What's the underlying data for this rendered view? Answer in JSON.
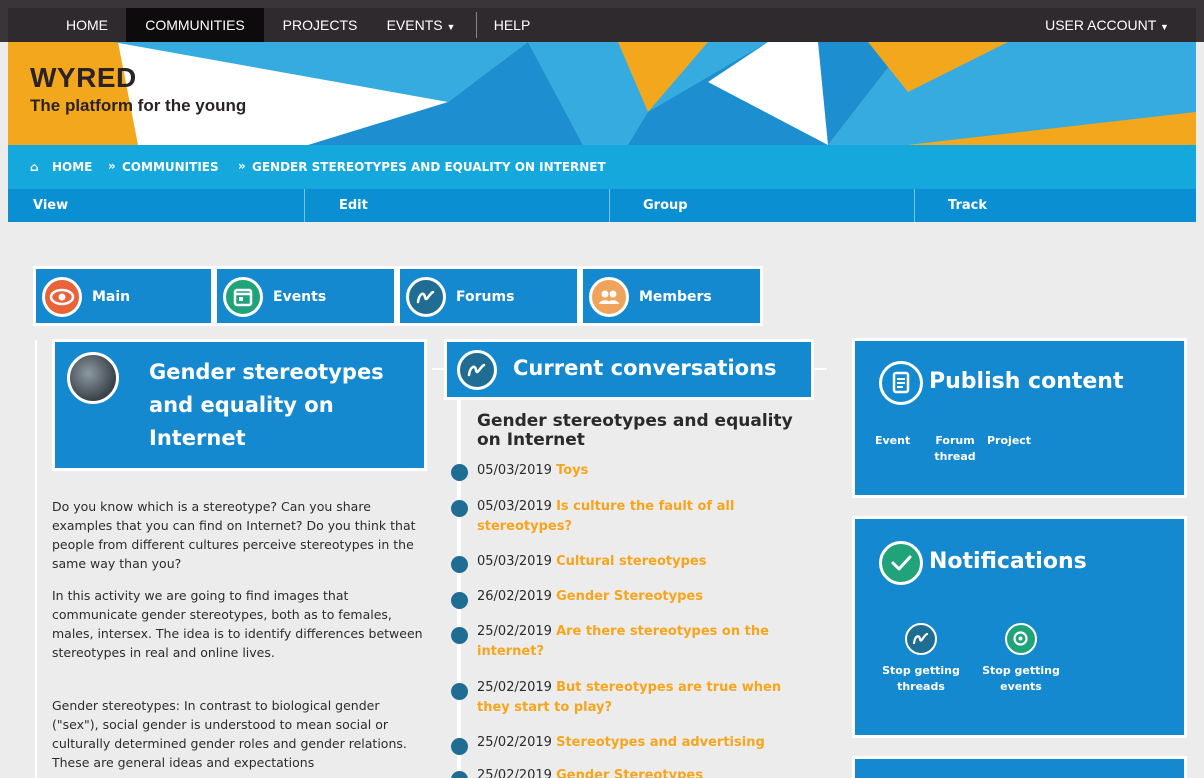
{
  "nav": {
    "items": [
      "HOME",
      "COMMUNITIES",
      "PROJECTS",
      "EVENTS",
      "HELP"
    ],
    "active": "COMMUNITIES",
    "account": "USER ACCOUNT"
  },
  "brand": {
    "title": "WYRED",
    "tagline": "The platform for the young"
  },
  "colors": {
    "accent_blue": "#1589cf",
    "orange": "#f3a71d",
    "link_orange": "#f6a51d",
    "dark": "#2f2a2e"
  },
  "breadcrumb": [
    "HOME",
    "COMMUNITIES",
    "GENDER STEREOTYPES AND EQUALITY ON INTERNET"
  ],
  "action_tabs": [
    "View",
    "Edit",
    "Group",
    "Track"
  ],
  "community_tabs": [
    {
      "label": "Main",
      "icon": "eye-icon"
    },
    {
      "label": "Events",
      "icon": "calendar-icon"
    },
    {
      "label": "Forums",
      "icon": "forum-icon"
    },
    {
      "label": "Members",
      "icon": "members-icon"
    }
  ],
  "group": {
    "title": "Gender stereotypes and equality on Internet",
    "description": [
      "Do you know which is a stereotype? Can you share examples that you can find on Internet? Do you think that people from different cultures perceive stereotypes in the same way than you?",
      "In this activity we are going to find images that communicate gender stereotypes, both as to females, males, intersex. The idea is to identify differences between stereotypes in real and online lives.",
      "Gender stereotypes: In contrast to biological gender (\"sex\"), social gender is understood to mean social or culturally determined gender roles and gender relations. These are general ideas and expectations"
    ]
  },
  "conversations": {
    "title": "Current conversations",
    "group_title": "Gender stereotypes and equality on Internet",
    "items": [
      {
        "date": "05/03/2019",
        "title": "Toys"
      },
      {
        "date": "05/03/2019",
        "title": "Is culture the fault of all stereotypes?"
      },
      {
        "date": "05/03/2019",
        "title": "Cultural stereotypes"
      },
      {
        "date": "26/02/2019",
        "title": "Gender Stereotypes"
      },
      {
        "date": "25/02/2019",
        "title": "Are there stereotypes on the internet?"
      },
      {
        "date": "25/02/2019",
        "title": "But stereotypes are true when they start to play?"
      },
      {
        "date": "25/02/2019",
        "title": "Stereotypes and advertising"
      },
      {
        "date": "25/02/2019",
        "title": "Gender Stereotypes"
      }
    ]
  },
  "publish": {
    "title": "Publish content",
    "links": [
      "Event",
      "Forum thread",
      "Project"
    ]
  },
  "notifications": {
    "title": "Notifications",
    "actions": [
      "Stop getting threads",
      "Stop getting events"
    ]
  }
}
